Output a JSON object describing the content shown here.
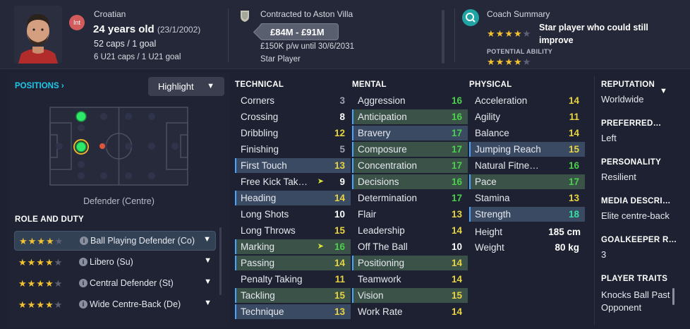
{
  "player": {
    "nationality": "Croatian",
    "international_badge": "Int",
    "age": "24 years old",
    "dob": "(23/1/2002)",
    "caps": "52 caps / 1 goal",
    "u21_caps": "6 U21 caps / 1 U21 goal"
  },
  "contract": {
    "title": "Contracted to Aston Villa",
    "value": "£84M - £91M",
    "wage": "£150K p/w until 30/6/2031",
    "status": "Star Player"
  },
  "coach": {
    "title": "Coach Summary",
    "current_ability_stars": 4,
    "summary": "Star player who could still improve",
    "potential_label": "POTENTIAL ABILITY",
    "potential_ability_stars": 4
  },
  "positions": {
    "link": "POSITIONS",
    "highlight_label": "Highlight",
    "position_label": "Defender (Centre)"
  },
  "role_duty": {
    "title": "ROLE AND DUTY",
    "roles": [
      {
        "name": "Ball Playing Defender (Co)",
        "stars": 4
      },
      {
        "name": "Libero (Su)",
        "stars": 4
      },
      {
        "name": "Central Defender (St)",
        "stars": 4
      },
      {
        "name": "Wide Centre-Back (De)",
        "stars": 4
      }
    ]
  },
  "technical": {
    "title": "TECHNICAL",
    "attrs": [
      {
        "name": "Corners",
        "value": "3"
      },
      {
        "name": "Crossing",
        "value": "8"
      },
      {
        "name": "Dribbling",
        "value": "12"
      },
      {
        "name": "Finishing",
        "value": "5"
      },
      {
        "name": "First Touch",
        "value": "13"
      },
      {
        "name": "Free Kick Tak…",
        "value": "9"
      },
      {
        "name": "Heading",
        "value": "14"
      },
      {
        "name": "Long Shots",
        "value": "10"
      },
      {
        "name": "Long Throws",
        "value": "15"
      },
      {
        "name": "Marking",
        "value": "16"
      },
      {
        "name": "Passing",
        "value": "14"
      },
      {
        "name": "Penalty Taking",
        "value": "11"
      },
      {
        "name": "Tackling",
        "value": "15"
      },
      {
        "name": "Technique",
        "value": "13"
      }
    ]
  },
  "mental": {
    "title": "MENTAL",
    "attrs": [
      {
        "name": "Aggression",
        "value": "16"
      },
      {
        "name": "Anticipation",
        "value": "16"
      },
      {
        "name": "Bravery",
        "value": "17"
      },
      {
        "name": "Composure",
        "value": "17"
      },
      {
        "name": "Concentration",
        "value": "17"
      },
      {
        "name": "Decisions",
        "value": "16"
      },
      {
        "name": "Determination",
        "value": "17"
      },
      {
        "name": "Flair",
        "value": "13"
      },
      {
        "name": "Leadership",
        "value": "14"
      },
      {
        "name": "Off The Ball",
        "value": "10"
      },
      {
        "name": "Positioning",
        "value": "14"
      },
      {
        "name": "Teamwork",
        "value": "14"
      },
      {
        "name": "Vision",
        "value": "15"
      },
      {
        "name": "Work Rate",
        "value": "14"
      }
    ]
  },
  "physical": {
    "title": "PHYSICAL",
    "attrs": [
      {
        "name": "Acceleration",
        "value": "14"
      },
      {
        "name": "Agility",
        "value": "11"
      },
      {
        "name": "Balance",
        "value": "14"
      },
      {
        "name": "Jumping Reach",
        "value": "15"
      },
      {
        "name": "Natural Fitne…",
        "value": "16"
      },
      {
        "name": "Pace",
        "value": "17"
      },
      {
        "name": "Stamina",
        "value": "13"
      },
      {
        "name": "Strength",
        "value": "18"
      }
    ],
    "height_label": "Height",
    "height": "185 cm",
    "weight_label": "Weight",
    "weight": "80 kg"
  },
  "info": {
    "reputation_label": "REPUTATION",
    "reputation": "Worldwide",
    "foot_label": "PREFERRED…",
    "foot": "Left",
    "personality_label": "PERSONALITY",
    "personality": "Resilient",
    "media_label": "MEDIA DESCRI…",
    "media": "Elite centre-back",
    "gk_label": "GOALKEEPER R…",
    "gk": "3",
    "traits_label": "PLAYER TRAITS",
    "traits": "Knocks Ball Past Opponent"
  },
  "colors": {
    "background": "#1d2131",
    "accent": "#1fc8e8",
    "star": "#f2c230",
    "highlight_blue": "#3b4a63",
    "highlight_green": "#3b5249"
  }
}
